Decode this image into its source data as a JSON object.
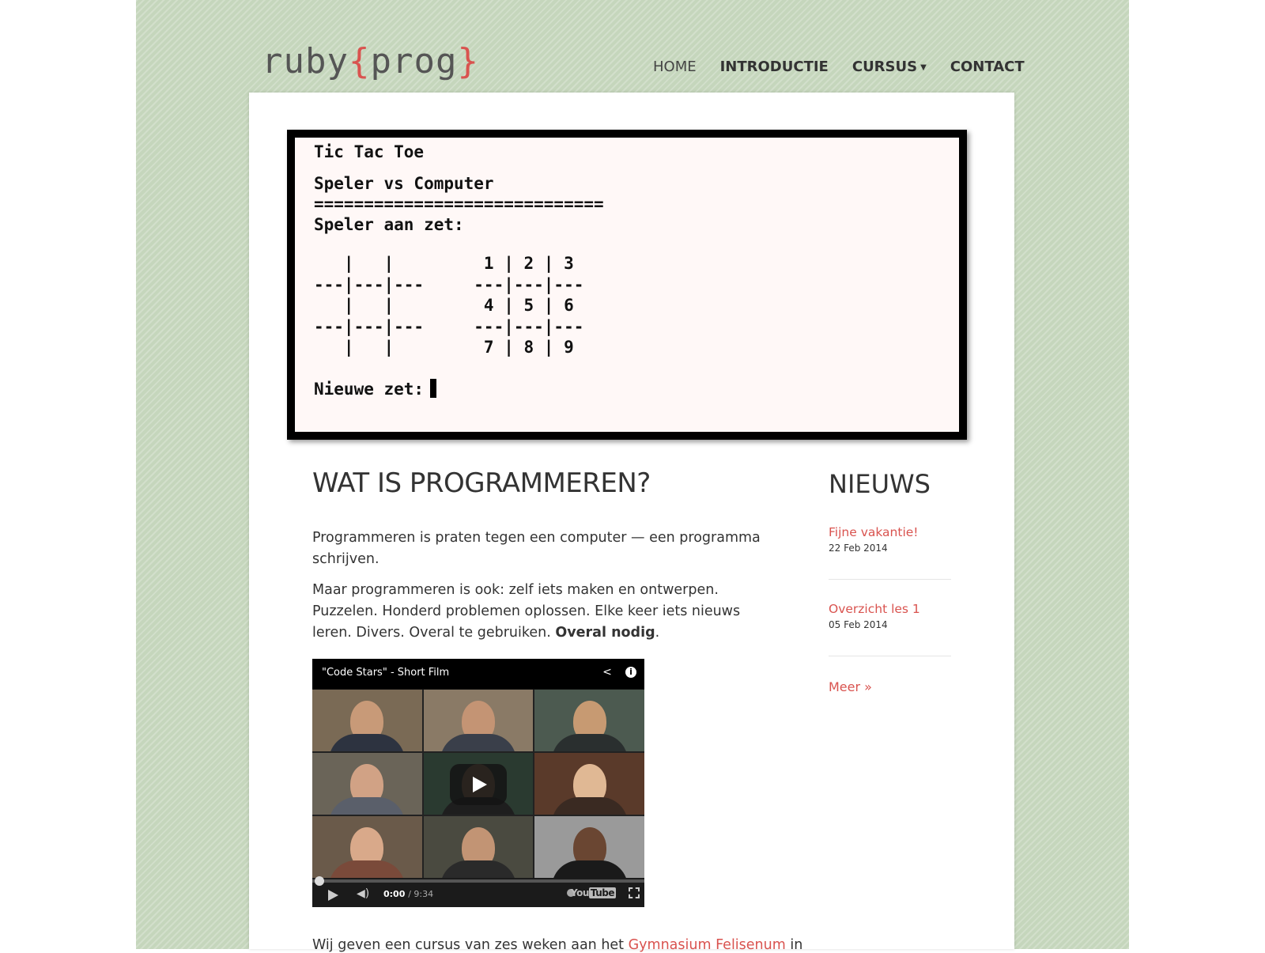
{
  "logo": {
    "prefix": "ruby",
    "open_brace": "{",
    "name": "prog",
    "close_brace": "}"
  },
  "nav": {
    "home": "HOME",
    "intro": "INTRODUCTIE",
    "course": "CURSUS",
    "contact": "CONTACT"
  },
  "terminal": {
    "title": "Tic Tac Toe",
    "mode": "Speler vs Computer",
    "separator": "=============================",
    "turn": "Speler aan zet:",
    "board_rows": [
      "   |   |         1 | 2 | 3",
      "---|---|---     ---|---|---",
      "   |   |         4 | 5 | 6",
      "---|---|---     ---|---|---",
      "   |   |         7 | 8 | 9"
    ],
    "prompt": "Nieuwe zet:"
  },
  "main": {
    "heading": "WAT IS PROGRAMMEREN?",
    "para1": "Programmeren is praten tegen een computer — een programma schrijven.",
    "para2_start": "Maar programmeren is ook: zelf iets maken en ontwerpen. Puzzelen. Honderd problemen oplossen. Elke keer iets nieuws leren. Divers. Overal te gebruiken. ",
    "para2_strong": "Overal nodig",
    "para2_end": ".",
    "bottom_start": "Wij geven een cursus van zes weken aan het ",
    "bottom_link": "Gymnasium Felisenum",
    "bottom_end": " in"
  },
  "video": {
    "title": "\"Code Stars\" - Short Film",
    "current_time": "0:00",
    "duration": "/ 9:34",
    "progress": 0,
    "logo_text_a": "You",
    "logo_text_b": "Tube"
  },
  "news": {
    "heading": "NIEUWS",
    "items": [
      {
        "title": "Fijne vakantie!",
        "date": "22 Feb 2014"
      },
      {
        "title": "Overzicht les 1",
        "date": "05 Feb 2014"
      }
    ],
    "more": "Meer »"
  },
  "colors": {
    "accent": "#d9534f",
    "background_green": "#c5d6bc"
  }
}
